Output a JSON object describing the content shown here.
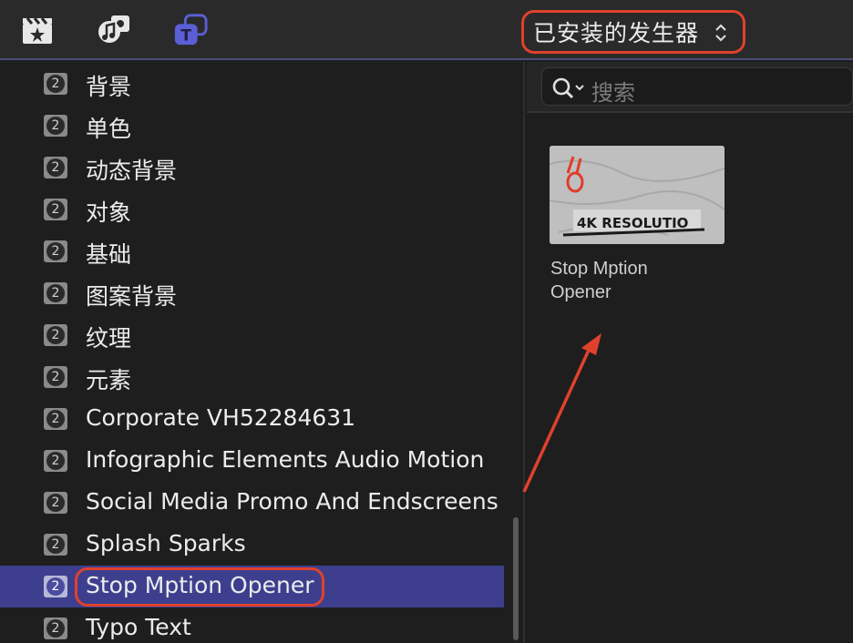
{
  "toolbar": {
    "icons": [
      "clapper-star-icon",
      "music-photo-icon",
      "titles-icon"
    ],
    "dropdown_label": "已安装的发生器"
  },
  "sidebar": {
    "items": [
      {
        "label": "背景",
        "badge": "2"
      },
      {
        "label": "单色",
        "badge": "2"
      },
      {
        "label": "动态背景",
        "badge": "2"
      },
      {
        "label": "对象",
        "badge": "2"
      },
      {
        "label": "基础",
        "badge": "2"
      },
      {
        "label": "图案背景",
        "badge": "2"
      },
      {
        "label": "纹理",
        "badge": "2"
      },
      {
        "label": "元素",
        "badge": "2"
      },
      {
        "label": "Corporate VH52284631",
        "badge": "2"
      },
      {
        "label": "Infographic Elements Audio Motion",
        "badge": "2"
      },
      {
        "label": "Social Media Promo And Endscreens",
        "badge": "2"
      },
      {
        "label": "Splash Sparks",
        "badge": "2"
      },
      {
        "label": "Stop Mption Opener",
        "badge": "2",
        "selected": true
      },
      {
        "label": "Typo Text",
        "badge": "2"
      }
    ]
  },
  "browser": {
    "search_placeholder": "搜索",
    "thumbnail": {
      "image_text": "4K RESOLUTIO",
      "title_line1": "Stop Mption",
      "title_line2": "Opener"
    }
  },
  "colors": {
    "selection": "#3d3f8e",
    "highlight": "#e0412d",
    "accent": "#5b5fd6"
  }
}
